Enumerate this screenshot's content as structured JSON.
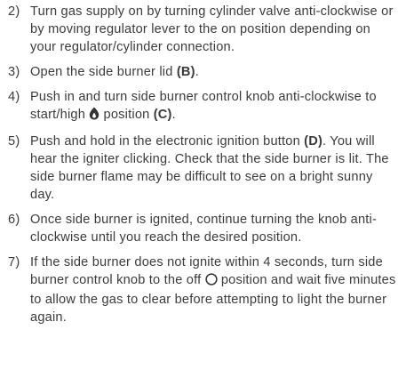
{
  "steps": [
    {
      "number": "2)",
      "text": "Turn gas supply on by turning cylinder valve anti-clockwise or by moving regulator lever to the on position depending on your regulator/cylinder connection."
    },
    {
      "number": "3)",
      "text_before": "Open the side burner lid ",
      "ref": "(B)",
      "text_after": "."
    },
    {
      "number": "4)",
      "text_before": "Push in and turn side burner control knob anti-clockwise to start/high ",
      "icon": "flame-icon",
      "text_middle": " position ",
      "ref": "(C)",
      "text_after": "."
    },
    {
      "number": "5)",
      "text_before": "Push and hold in the electronic ignition button ",
      "ref": "(D)",
      "text_after": ". You will hear the igniter clicking. Check that the side burner is lit. The side burner flame may be difficult to see on a bright sunny day."
    },
    {
      "number": "6)",
      "text": "Once side burner is ignited, continue turning the knob anti-clockwise until you reach the desired position."
    },
    {
      "number": "7)",
      "text_before": "If the side burner does not ignite within 4 seconds, turn side burner control knob to the off ",
      "icon": "off-circle-icon",
      "text_after": " position and wait five minutes to allow the gas to clear before attempting to light the burner again."
    }
  ]
}
